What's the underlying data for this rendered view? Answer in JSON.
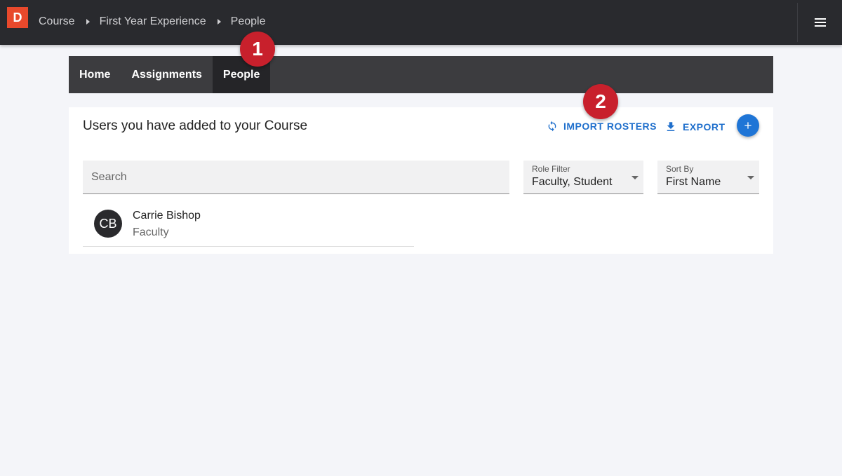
{
  "header": {
    "logo_letter": "D",
    "breadcrumbs": [
      "Course",
      "First Year Experience",
      "People"
    ]
  },
  "nav": {
    "tabs": [
      {
        "label": "Home",
        "active": false
      },
      {
        "label": "Assignments",
        "active": false
      },
      {
        "label": "People",
        "active": true
      }
    ]
  },
  "panel": {
    "title": "Users you have added to your Course",
    "import_label": "IMPORT ROSTERS",
    "export_label": "EXPORT",
    "add_icon": "plus-icon",
    "search_placeholder": "Search",
    "role_filter": {
      "label": "Role Filter",
      "value": "Faculty, Student"
    },
    "sort_by": {
      "label": "Sort By",
      "value": "First Name"
    },
    "users": [
      {
        "initials": "CB",
        "name": "Carrie Bishop",
        "role": "Faculty"
      }
    ]
  },
  "callouts": [
    "1",
    "2"
  ],
  "colors": {
    "topbar": "#292a2e",
    "logo": "#e8492c",
    "accent": "#1f6fcc",
    "fab": "#1f75d6",
    "callout": "#c8202c"
  }
}
